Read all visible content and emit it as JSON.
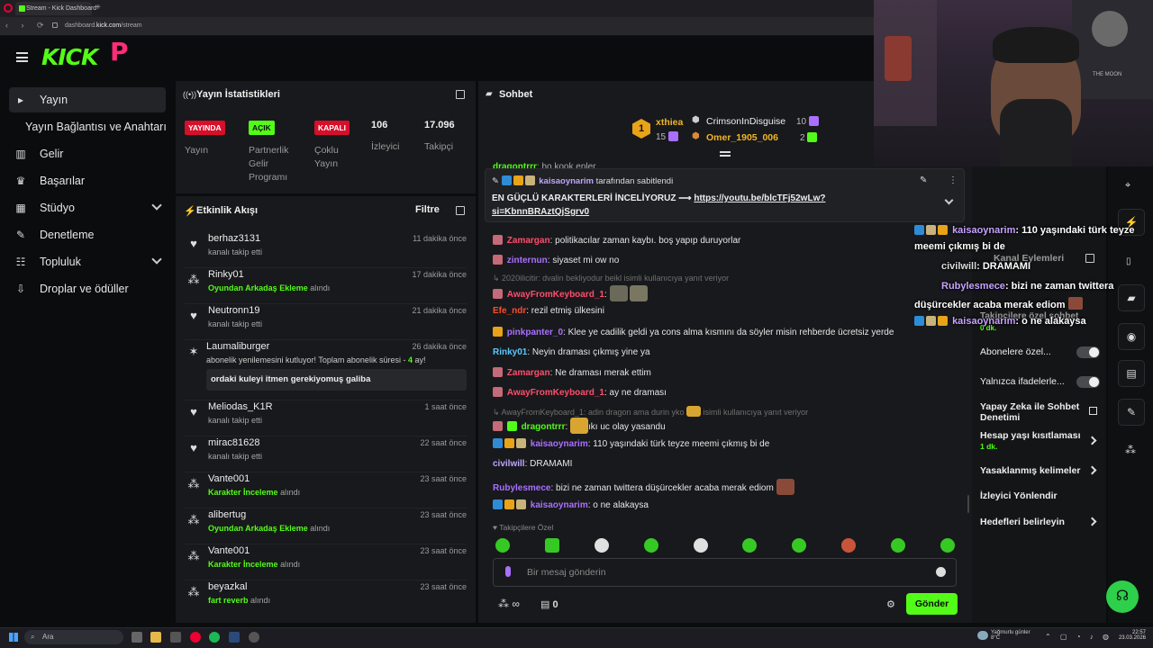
{
  "browser": {
    "tab_title": "Stream - Kick Dashboard",
    "new_tab": "+",
    "url_prefix": "dashboard.",
    "url_domain": "kick.com",
    "url_path": "/stream"
  },
  "header": {
    "logo": "KICK",
    "logo_mark": "P"
  },
  "sidebar": {
    "items": [
      {
        "label": "Yayın",
        "icon": "broadcast-icon"
      },
      {
        "label": "Yayın Bağlantısı ve Anahtarı",
        "icon": ""
      },
      {
        "label": "Gelir",
        "icon": "chart-icon"
      },
      {
        "label": "Başarılar",
        "icon": "trophy-icon"
      },
      {
        "label": "Stüdyo",
        "icon": "studio-icon"
      },
      {
        "label": "Denetleme",
        "icon": "wrench-icon"
      },
      {
        "label": "Topluluk",
        "icon": "community-icon"
      },
      {
        "label": "Droplar ve ödüller",
        "icon": "drops-icon"
      }
    ]
  },
  "stats": {
    "title": "Yayın İstatistikleri",
    "yayin_badge": "YAYINDA",
    "yayin_label": "Yayın",
    "partner_badge": "AÇIK",
    "partner_label_1": "Partnerlik",
    "partner_label_2": "Gelir",
    "partner_label_3": "Programı",
    "multi_badge": "KAPALI",
    "multi_label_1": "Çoklu",
    "multi_label_2": "Yayın",
    "viewers": "106",
    "viewers_label": "İzleyici",
    "followers": "17.096",
    "followers_label": "Takipçi",
    "colors": {
      "live": "#d60f2a",
      "on": "#53fc18"
    }
  },
  "activity": {
    "title": "Etkinlik Akışı",
    "filter": "Filtre",
    "items": [
      {
        "name": "berhaz3131",
        "sub": "kanalı takip etti",
        "sub_green": "",
        "time": "11 dakika önce"
      },
      {
        "name": "Rinky01",
        "sub": "alındı",
        "sub_green": "Oyundan Arkadaş Ekleme",
        "time": "17 dakika önce"
      },
      {
        "name": "Neutronn19",
        "sub": "kanalı takip etti",
        "sub_green": "",
        "time": "21 dakika önce"
      },
      {
        "name": "Laumaliburger",
        "sub": "abonelik yenilemesini kutluyor! Toplam abonelik süresi - ",
        "sub_months": "4",
        "sub_tail": " ay!",
        "message": "ordaki kuleyi itmen gerekiyomuş galiba",
        "time": "26 dakika önce"
      },
      {
        "name": "Meliodas_K1R",
        "sub": "kanalı takip etti",
        "sub_green": "",
        "time": "1 saat önce"
      },
      {
        "name": "mirac81628",
        "sub": "kanalı takip etti",
        "sub_green": "",
        "time": "22 saat önce"
      },
      {
        "name": "Vante001",
        "sub": "alındı",
        "sub_green": "Karakter İnceleme",
        "time": "23 saat önce"
      },
      {
        "name": "alibertug",
        "sub": "alındı",
        "sub_green": "Oyundan Arkadaş Ekleme",
        "time": "23 saat önce"
      },
      {
        "name": "Vante001",
        "sub": "alındı",
        "sub_green": "Karakter İnceleme",
        "time": "23 saat önce"
      },
      {
        "name": "beyazkal",
        "sub": "alındı",
        "sub_green": "fart reverb",
        "time": "23 saat önce"
      }
    ]
  },
  "chat": {
    "title": "Sohbet",
    "leaderboard": {
      "first": "xthiea",
      "first_count": "15",
      "second": "CrimsonInDisguise",
      "second_count": "10",
      "third": "Omer_1905_006",
      "third_count": "2",
      "rank": "1"
    },
    "partial_user": "dragontrrr",
    "partial_text": "ho kook enler",
    "pinned": {
      "pinned_by": "kaisaoynarim",
      "pinned_text": "tarafından sabitlendi",
      "message": "EN GÜÇLÜ KARAKTERLERİ İNCELİYORUZ ⟶ ",
      "link_1": "https://youtu.be/blcTFj52wLw?",
      "link_2": "si=KbnnBRAztQjSgrv0"
    },
    "messages": [
      {
        "user": "Zamargan",
        "color": "#ff4d6d",
        "text": "politikacılar zaman kaybı. boş yapıp duruyorlar"
      },
      {
        "user": "zinternun",
        "color": "#a970ff",
        "text": "siyaset mi ow no"
      },
      {
        "user": "AwayFromKeyboard_1",
        "color": "#ff4d6d",
        "text": ""
      },
      {
        "user": "Efe_ndr",
        "color": "#ff4d2d",
        "text": "rezil etmiş ülkesini"
      },
      {
        "user": "pinkpanter_0",
        "color": "#a970ff",
        "text": "Klee ye cadilik geldi ya cons alma kısmını da söyler misin rehberde ücretsiz yerde"
      },
      {
        "user": "Rinky01",
        "color": "#5cc8ff",
        "text": "Neyin draması çıkmış yine ya"
      },
      {
        "user": "Zamargan",
        "color": "#ff4d6d",
        "text": "Ne draması merak ettim"
      },
      {
        "user": "AwayFromKeyboard_1",
        "color": "#ff4d6d",
        "text": "ay ne draması"
      },
      {
        "user": "dragontrrr",
        "color": "#53fc18",
        "text": "ıkı uc olay yasandu"
      },
      {
        "user": "kaisaoynarim",
        "color": "#a970ff",
        "text": "110 yaşındaki türk teyze meemi çıkmış bi de"
      },
      {
        "user": "civilwill",
        "color": "#bfa6ff",
        "text": "DRAMAMI"
      },
      {
        "user": "Rubylesmece",
        "color": "#a970ff",
        "text": "bizi ne zaman twittera düşürcekler acaba merak ediom"
      },
      {
        "user": "kaisaoynarim",
        "color": "#a970ff",
        "text": "o ne alakaysa"
      }
    ],
    "reply_1_user": "2020ilicitir",
    "reply_1_text": ": dvalin bekliyodur beikl isimli kullanıcıya yanıt veriyor",
    "reply_2_user": "AwayFromKeyboard_1",
    "reply_2_text": ": adin dragon ama durin yko",
    "reply_2_tail": "isimli kullanıcıya yanıt veriyor",
    "followers_only": "Takipçilere Özel",
    "input_placeholder": "Bir mesaj gönderin",
    "points": "∞",
    "store_count": "0",
    "send": "Gönder"
  },
  "right_panel": {
    "title": "Kanal Eylemleri",
    "followers_only_partial": "Takipçilere özel sohbet",
    "followers_only_sub": "0 dk.",
    "subs_only": "Abonelere özel...",
    "emotes_only": "Yalnızca ifadelerle...",
    "ai_mod_1": "Yapay Zeka ile Sohbet",
    "ai_mod_2": "Denetimi",
    "account_age": "Hesap yaşı kısıtlaması",
    "account_age_val": "1 dk.",
    "banned_words": "Yasaklanmış kelimeler",
    "raid": "İzleyici Yönlendir",
    "goals": "Hedefleri belirleyin"
  },
  "overlay_chat": [
    {
      "user": "kaisaoynarim",
      "text": ": 110 yaşındaki türk teyze"
    },
    {
      "user": "",
      "text": "meemi çıkmış bi de"
    },
    {
      "user": "civilwill",
      "text": ": DRAMAMI"
    },
    {
      "user": "Rubylesmece",
      "text": ": bizi ne zaman twittera"
    },
    {
      "user": "",
      "text": "düşürcekler acaba merak ediom"
    },
    {
      "user": "kaisaoynarim",
      "text": ": o ne alakaysa"
    }
  ],
  "webcam_text": "THE MOON",
  "taskbar": {
    "search": "Ara",
    "weather_1": "Yağmurlu günler",
    "weather_2": "8°C",
    "time": "22:57",
    "date": "23.03.2026"
  }
}
